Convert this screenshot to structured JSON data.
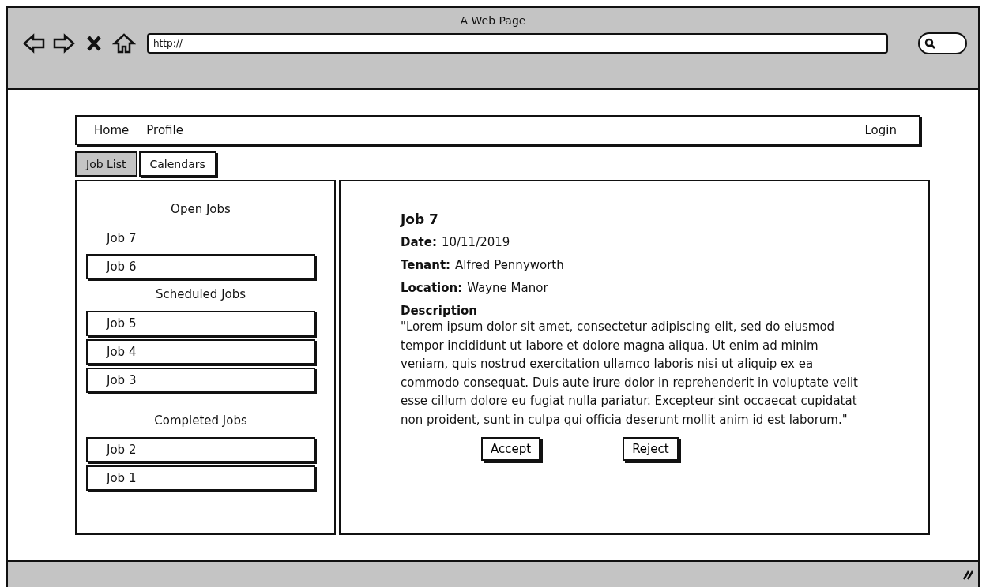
{
  "window": {
    "title": "A Web Page"
  },
  "address_bar": {
    "value": "http://"
  },
  "nav": {
    "left": [
      "Home",
      "Profile"
    ],
    "right": "Login"
  },
  "tabs": [
    {
      "label": "Job List",
      "selected": true
    },
    {
      "label": "Calendars",
      "selected": false
    }
  ],
  "job_groups": [
    {
      "title": "Open Jobs",
      "jobs": [
        {
          "label": "Job 7",
          "selected": true
        },
        {
          "label": "Job 6",
          "selected": false
        }
      ]
    },
    {
      "title": "Scheduled Jobs",
      "jobs": [
        {
          "label": "Job 5",
          "selected": false
        },
        {
          "label": "Job 4",
          "selected": false
        },
        {
          "label": "Job 3",
          "selected": false
        }
      ]
    },
    {
      "title": "Completed Jobs",
      "jobs": [
        {
          "label": "Job 2",
          "selected": false
        },
        {
          "label": "Job 1",
          "selected": false
        }
      ]
    }
  ],
  "detail": {
    "title": "Job 7",
    "fields": [
      {
        "label": "Date:",
        "value": "10/11/2019"
      },
      {
        "label": "Tenant:",
        "value": "Alfred Pennyworth"
      },
      {
        "label": "Location:",
        "value": "Wayne Manor"
      }
    ],
    "description_label": "Description",
    "description": "\"Lorem ipsum dolor sit amet, consectetur adipiscing elit, sed do eiusmod tempor incididunt ut labore et dolore magna aliqua. Ut enim ad minim veniam, quis nostrud exercitation ullamco laboris nisi ut aliquip ex ea commodo consequat. Duis aute irure dolor in reprehenderit in voluptate velit esse cillum dolore eu fugiat nulla pariatur. Excepteur sint occaecat cupidatat non proident, sunt in culpa qui officia deserunt mollit anim id est laborum.\"",
    "buttons": [
      "Accept",
      "Reject"
    ]
  }
}
